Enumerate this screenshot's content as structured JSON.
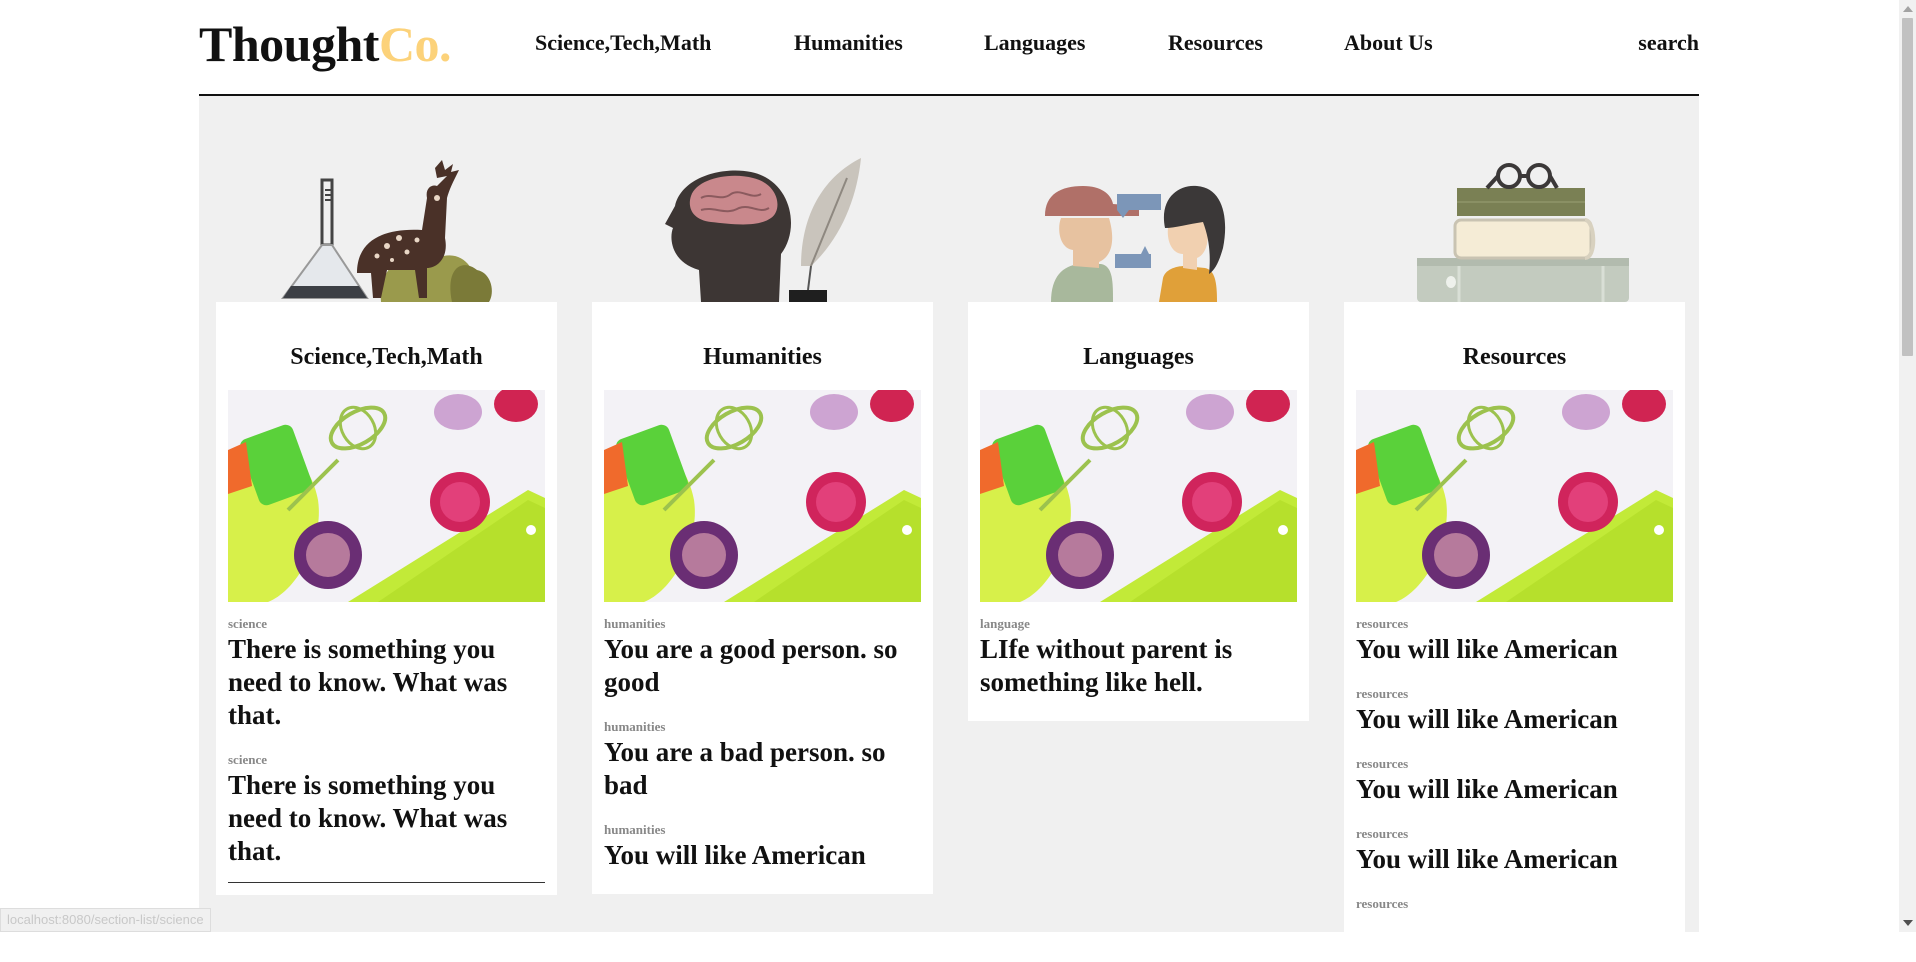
{
  "brand": {
    "name": "Thought",
    "suffix": "Co.",
    "accent": "#fcd27a"
  },
  "nav": {
    "items": [
      {
        "label": "Science,Tech,Math"
      },
      {
        "label": "Humanities"
      },
      {
        "label": "Languages"
      },
      {
        "label": "Resources"
      },
      {
        "label": "About Us"
      }
    ],
    "search": "search"
  },
  "sections": [
    {
      "title": "Science,Tech,Math",
      "articles": [
        {
          "category": "science",
          "title": "There is something you need to know. What was that."
        },
        {
          "category": "science",
          "title": "There is something you need to know. What was that."
        }
      ]
    },
    {
      "title": "Humanities",
      "articles": [
        {
          "category": "humanities",
          "title": "You are a good person. so good"
        },
        {
          "category": "humanities",
          "title": "You are a bad person. so bad"
        },
        {
          "category": "humanities",
          "title": "You will like American"
        }
      ]
    },
    {
      "title": "Languages",
      "articles": [
        {
          "category": "language",
          "title": "LIfe without parent is something like hell."
        }
      ]
    },
    {
      "title": "Resources",
      "articles": [
        {
          "category": "resources",
          "title": "You will like American"
        },
        {
          "category": "resources",
          "title": "You will like American"
        },
        {
          "category": "resources",
          "title": "You will like American"
        },
        {
          "category": "resources",
          "title": "You will like American"
        },
        {
          "category": "resources",
          "title": ""
        }
      ]
    }
  ],
  "status_bar": "localhost:8080/section-list/science"
}
